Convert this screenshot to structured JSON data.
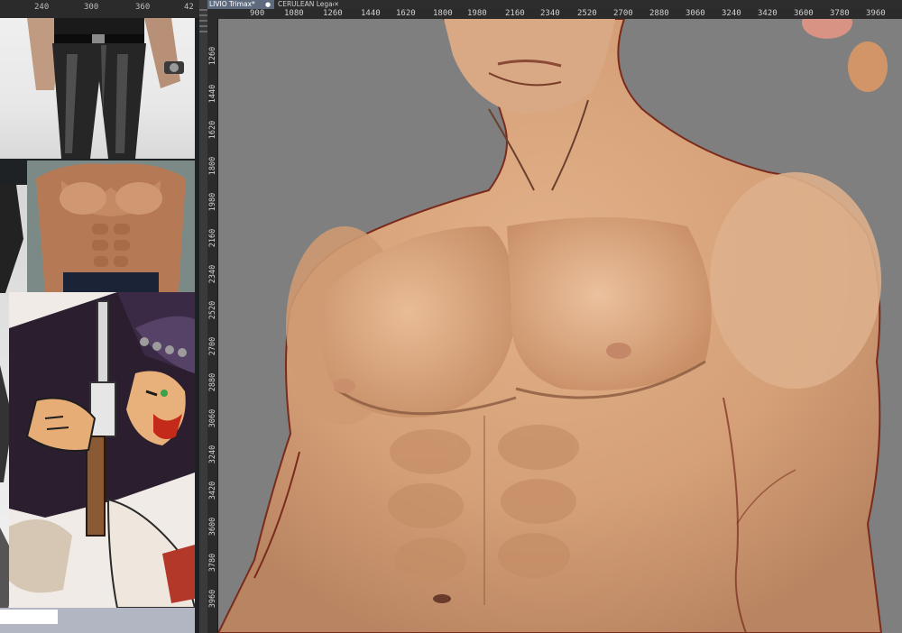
{
  "tabs": [
    {
      "label": "LIVIO Trimax*",
      "active": true
    },
    {
      "label": "CERULEAN Legacy",
      "active": false
    }
  ],
  "icons": {
    "tab_modified": "filled-dot-icon",
    "tab_close": "close-icon"
  },
  "left_ruler": [
    "240",
    "300",
    "360",
    "42"
  ],
  "top_ruler": [
    "900",
    "1080",
    "1260",
    "1440",
    "1620",
    "1800",
    "1980",
    "2160",
    "2340",
    "2520",
    "2700",
    "2880",
    "3060",
    "3240",
    "3420",
    "3600",
    "3780",
    "3960"
  ],
  "left_ruler_vertical": [
    "1260",
    "1440",
    "1620",
    "1800",
    "1980",
    "2160",
    "2340",
    "2520",
    "2700",
    "2880",
    "3060",
    "3240",
    "3420",
    "3600",
    "3780",
    "3960"
  ],
  "colors": {
    "canvas_bg": "#7f7f7f",
    "skin": "#d9a57d",
    "line_art": "#7a2b1d",
    "swatch_pink": "#d89385",
    "swatch_tan": "#d29568",
    "tab_active": "#5e6b7f"
  }
}
